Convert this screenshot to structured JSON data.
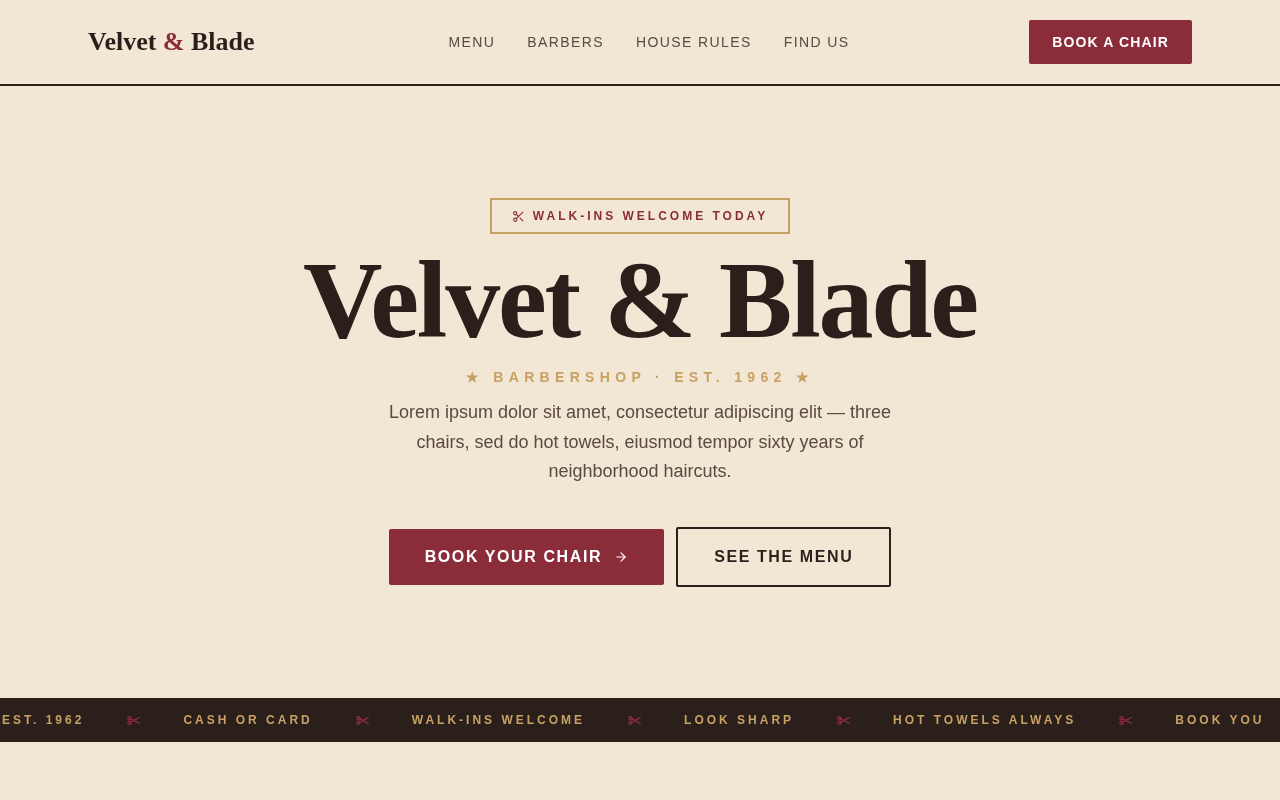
{
  "header": {
    "logo": [
      {
        "text": "Velvet",
        "accent": false
      },
      {
        "text": "&",
        "accent": true
      },
      {
        "text": "Blade",
        "accent": false
      }
    ],
    "nav": [
      {
        "label": "MENU"
      },
      {
        "label": "BARBERS"
      },
      {
        "label": "HOUSE RULES"
      },
      {
        "label": "FIND US"
      }
    ],
    "cta": "BOOK A CHAIR"
  },
  "hero": {
    "badge": "WALK-INS WELCOME TODAY",
    "title": "Velvet & Blade",
    "tagline": "★ BARBERSHOP · EST. 1962 ★",
    "description": "Lorem ipsum dolor sit amet, consectetur adipiscing elit — three chairs, sed do hot towels, eiusmod tempor sixty years of neighborhood haircuts.",
    "buttons": [
      {
        "label": "BOOK YOUR CHAIR",
        "kind": "primary"
      },
      {
        "label": "SEE THE MENU",
        "kind": "outline"
      }
    ]
  },
  "ticker": [
    "EST. 1962",
    "CASH OR CARD",
    "WALK-INS WELCOME",
    "LOOK SHARP",
    "HOT TOWELS ALWAYS",
    "BOOK YOU"
  ]
}
